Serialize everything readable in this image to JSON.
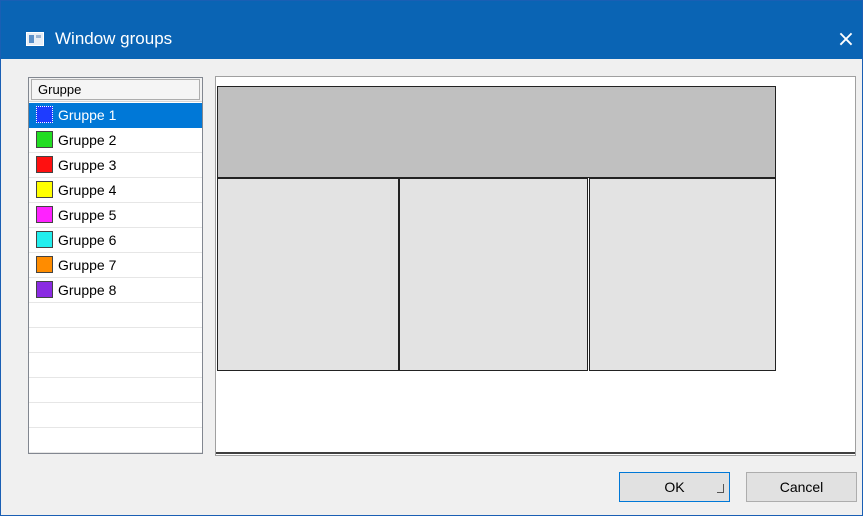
{
  "window": {
    "title": "Window groups",
    "close_icon": "×"
  },
  "list": {
    "header": "Gruppe",
    "selected_index": 0,
    "items": [
      {
        "label": "Gruppe 1",
        "color": "#1e3cff"
      },
      {
        "label": "Gruppe 2",
        "color": "#22dd22"
      },
      {
        "label": "Gruppe 3",
        "color": "#ff1010"
      },
      {
        "label": "Gruppe 4",
        "color": "#ffff00"
      },
      {
        "label": "Gruppe 5",
        "color": "#ff22ff"
      },
      {
        "label": "Gruppe 6",
        "color": "#22eeee"
      },
      {
        "label": "Gruppe 7",
        "color": "#ff8c00"
      },
      {
        "label": "Gruppe 8",
        "color": "#8a2be2"
      }
    ]
  },
  "buttons": {
    "ok": "OK",
    "cancel": "Cancel"
  }
}
